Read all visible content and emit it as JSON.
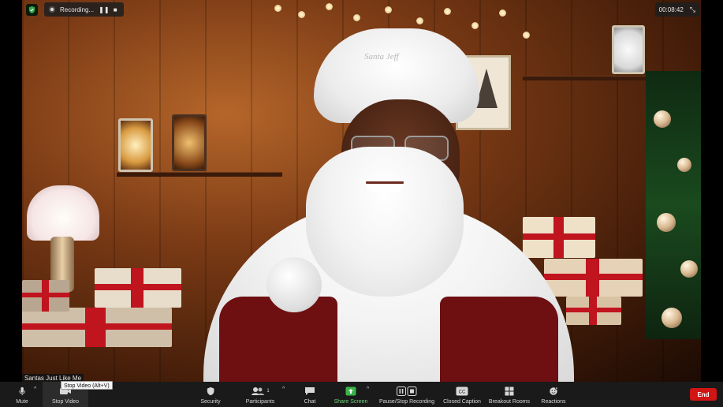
{
  "recording": {
    "label": "Recording...",
    "pause_icon": "pause-icon",
    "stop_icon": "stop-icon"
  },
  "timer": {
    "elapsed": "00:08:42",
    "collapse_icon": "exit-fullscreen-icon"
  },
  "security_badge_icon": "shield-check-icon",
  "video": {
    "participant_name": "Santas Just Like Me",
    "hat_text": "Santa Jeff"
  },
  "tooltip": "Stop Video (Alt+V)",
  "toolbar": {
    "mute": "Mute",
    "stop_video": "Stop Video",
    "security": "Security",
    "participants": "Participants",
    "participants_count": "1",
    "chat": "Chat",
    "share_screen": "Share Screen",
    "recording": "Pause/Stop Recording",
    "closed_caption": "Closed Caption",
    "breakout_rooms": "Breakout Rooms",
    "reactions": "Reactions",
    "end": "End"
  },
  "colors": {
    "share_green": "#3bb54a",
    "end_red": "#d11414",
    "toolbar_bg": "#1a1a1a"
  }
}
